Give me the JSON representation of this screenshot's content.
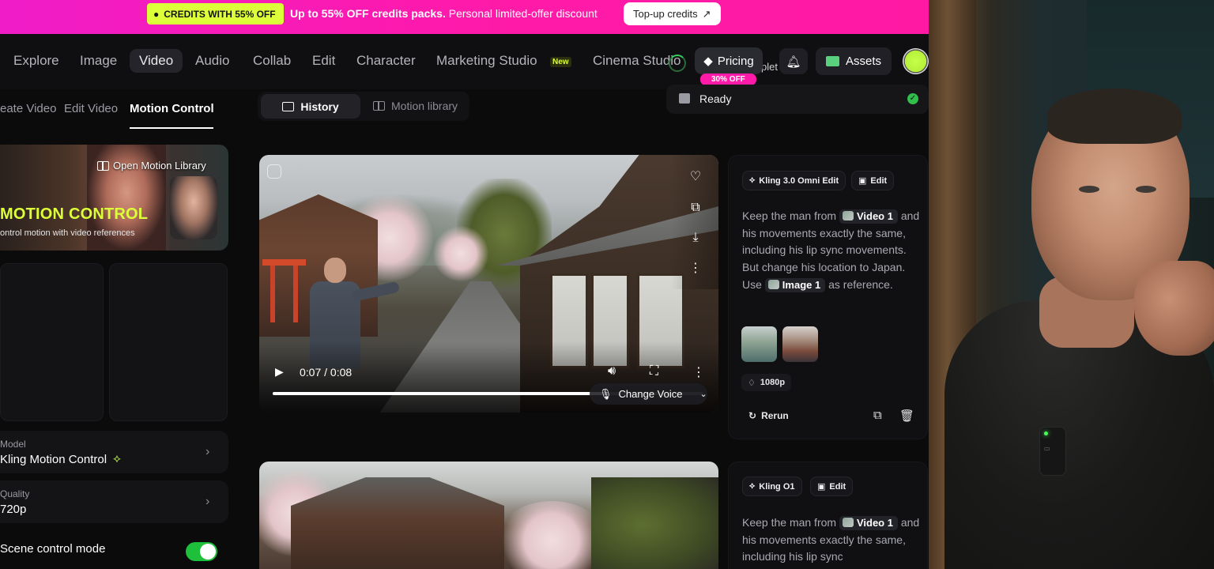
{
  "banner": {
    "tag": "CREDITS WITH 55% OFF",
    "headline": "Up to 55% OFF credits packs.",
    "subline": "Personal limited-offer discount",
    "topup_label": "Top-up credits",
    "topup_icon": "↗"
  },
  "nav": {
    "items": [
      "Explore",
      "Image",
      "Video",
      "Audio",
      "Collab",
      "Edit",
      "Character",
      "Marketing Studio",
      "Cinema Studio"
    ],
    "active": "Video",
    "new_badge": "New",
    "pricing_label": "Pricing",
    "pricing_badge": "30% OFF",
    "partial_text": "plet",
    "assets_label": "Assets"
  },
  "ready_panel": {
    "label": "Ready",
    "check": "✓"
  },
  "subtabs": [
    "eate Video",
    "Edit Video",
    "Motion Control"
  ],
  "motion_card": {
    "library_label": "Open Motion Library",
    "title": "MOTION CONTROL",
    "subtitle": "ontrol motion with video references"
  },
  "settings": {
    "model_label": "Model",
    "model_value": "Kling Motion Control",
    "quality_label": "Quality",
    "quality_value": "720p",
    "scene_label": "Scene control mode",
    "scene_enabled": true
  },
  "history_tabs": {
    "history": "History",
    "motion_library": "Motion library"
  },
  "video1": {
    "time": "0:07 / 0:08",
    "progress_fraction": 0.78,
    "change_voice": "Change Voice"
  },
  "card1": {
    "model_chip": "Kling 3.0 Omni Edit",
    "edit_chip": "Edit",
    "prompt_parts": [
      "Keep the man from",
      "Video 1",
      "and his movements exactly the same, including his lip sync movements. But change his location to Japan.",
      "Use",
      "Image 1",
      "as reference."
    ],
    "resolution": "1080p",
    "rerun": "Rerun"
  },
  "card2": {
    "model_chip": "Kling O1",
    "edit_chip": "Edit",
    "prompt_parts": [
      "Keep the man from",
      "Video 1",
      "and his movements exactly the same, including his lip sync"
    ]
  },
  "icons": {
    "tag": "tag-icon",
    "diamond": "diamond-icon",
    "bell": "bell-icon",
    "folder": "folder-icon",
    "heart": "heart-icon",
    "copy": "copy-icon",
    "download": "download-icon",
    "more": "more-icon"
  },
  "colors": {
    "banner_pink": "#ff1aa8",
    "accent_lime": "#dcff3a",
    "success_green": "#1ebf3a"
  }
}
